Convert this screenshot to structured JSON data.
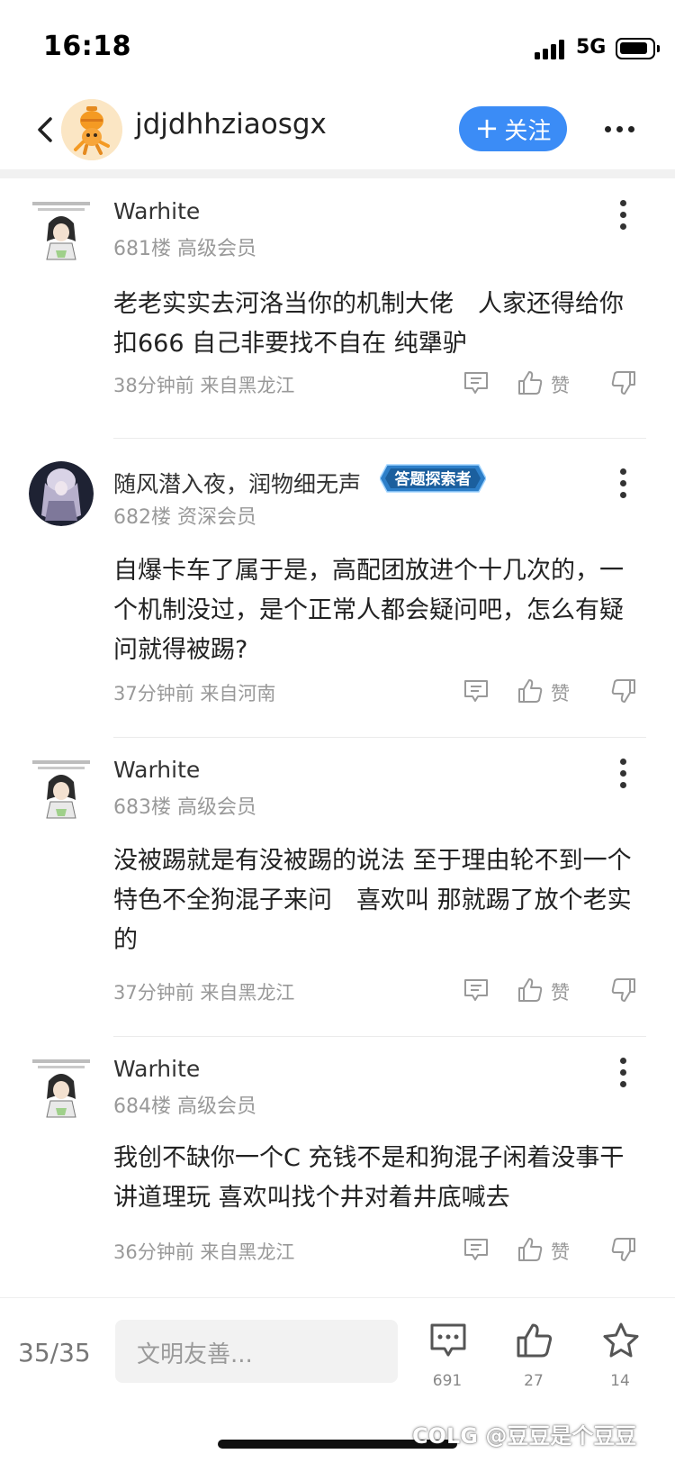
{
  "status_bar": {
    "time": "16:18",
    "network": "5G"
  },
  "header": {
    "username": "jdjdhhziaosgx",
    "follow_label": "关注"
  },
  "posts": [
    {
      "author": "Warhite",
      "meta": "681楼  高级会员",
      "content": "老老实实去河洛当你的机制大佬　人家还得给你扣666  自己非要找不自在  纯犟驴",
      "time": "38分钟前 来自黑龙江",
      "like_label": "赞"
    },
    {
      "author": "随风潜入夜，润物细无声",
      "meta": "682楼  资深会员",
      "badge": "答题探索者",
      "content": "自爆卡车了属于是，高配团放进个十几次的，一个机制没过，是个正常人都会疑问吧，怎么有疑问就得被踢?",
      "time": "37分钟前 来自河南",
      "like_label": "赞"
    },
    {
      "author": "Warhite",
      "meta": "683楼  高级会员",
      "content": "没被踢就是有没被踢的说法  至于理由轮不到一个特色不全狗混子来问　喜欢叫  那就踢了放个老实的",
      "time": "37分钟前 来自黑龙江",
      "like_label": "赞"
    },
    {
      "author": "Warhite",
      "meta": "684楼  高级会员",
      "content": "我创不缺你一个C  充钱不是和狗混子闲着没事干讲道理玩  喜欢叫找个井对着井底喊去",
      "time": "36分钟前 来自黑龙江",
      "like_label": "赞"
    }
  ],
  "bottom_bar": {
    "page": "35/35",
    "input_placeholder": "文明友善...",
    "comments": "691",
    "likes": "27",
    "favorites": "14"
  },
  "watermark": "COLG @豆豆是个豆豆",
  "colors": {
    "accent": "#3b8cf6",
    "badge": "#2d7fc9",
    "muted": "#999999"
  }
}
